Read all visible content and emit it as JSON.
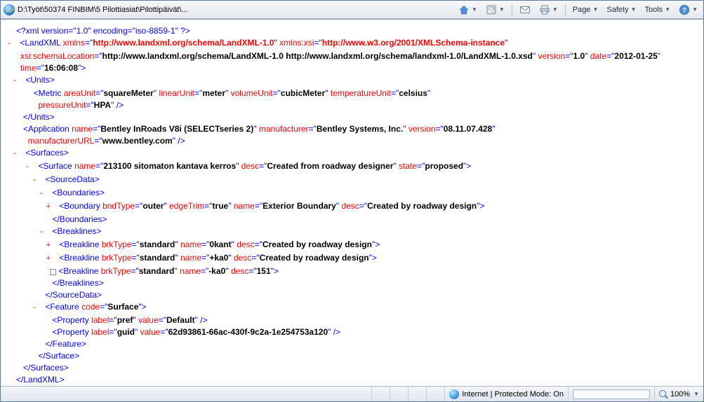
{
  "address": "D:\\Työt\\50374 FINBIM\\5 Pilottiasiat\\Pilottipäivät\\...",
  "toolbar": {
    "page": "Page",
    "safety": "Safety",
    "tools": "Tools"
  },
  "status": {
    "zone": "Internet | Protected Mode: On",
    "zoom": "100%"
  },
  "xml": {
    "pi": "<?xml version=\"1.0\" encoding=\"iso-8859-1\" ?>",
    "root_open": "<LandXML",
    "root_attrs": {
      "xmlns_k": "xmlns",
      "xmlns_v": "http://www.landxml.org/schema/LandXML-1.0",
      "xmlnsxsi_k": "xmlns:xsi",
      "xmlnsxsi_v": "http://www.w3.org/2001/XMLSchema-instance",
      "schemaLoc_k": "xsi:schemaLocation",
      "schemaLoc_v": "http://www.landxml.org/schema/LandXML-1.0 http://www.landxml.org/schema/landxml-1.0/LandXML-1.0.xsd",
      "version_k": "version",
      "version_v": "1.0",
      "date_k": "date",
      "date_v": "2012-01-25",
      "time_k": "time",
      "time_v": "16:06:08"
    },
    "units": {
      "open": "<Units>",
      "metric_open": "<Metric",
      "area_k": "areaUnit",
      "area_v": "squareMeter",
      "lin_k": "linearUnit",
      "lin_v": "meter",
      "vol_k": "volumeUnit",
      "vol_v": "cubicMeter",
      "temp_k": "temperatureUnit",
      "temp_v": "celsius",
      "press_k": "pressureUnit",
      "press_v": "HPA",
      "close": "</Units>"
    },
    "app": {
      "open": "<Application",
      "name_k": "name",
      "name_v": "Bentley InRoads V8i (SELECTseries 2)",
      "manu_k": "manufacturer",
      "manu_v": "Bentley Systems, Inc.",
      "ver_k": "version",
      "ver_v": "08.11.07.428",
      "url_k": "manufacturerURL",
      "url_v": "www.bentley.com"
    },
    "surfaces_open": "<Surfaces>",
    "surface": {
      "open": "<Surface",
      "name_k": "name",
      "name_v": "213100 sitomaton kantava kerros",
      "desc_k": "desc",
      "desc_v": "Created from roadway designer",
      "state_k": "state",
      "state_v": "proposed"
    },
    "sourcedata_open": "<SourceData>",
    "bounds_open": "<Boundaries>",
    "boundary": {
      "open": "<Boundary",
      "bnd_k": "bndType",
      "bnd_v": "outer",
      "et_k": "edgeTrim",
      "et_v": "true",
      "name_k": "name",
      "name_v": "Exterior Boundary",
      "desc_k": "desc",
      "desc_v": "Created by roadway design"
    },
    "bounds_close": "</Boundaries>",
    "breaks_open": "<Breaklines>",
    "bl1": {
      "open": "<Breakline",
      "tk": "brkType",
      "tv": "standard",
      "nk": "name",
      "nv": "0kant",
      "dk": "desc",
      "dv": "Created by roadway design"
    },
    "bl2": {
      "open": "<Breakline",
      "tk": "brkType",
      "tv": "standard",
      "nk": "name",
      "nv": "+ka0",
      "dk": "desc",
      "dv": "Created by roadway design"
    },
    "bl3": {
      "open": "<Breakline",
      "tk": "brkType",
      "tv": "standard",
      "nk": "name",
      "nv": "-ka0",
      "dk": "desc",
      "dv": "151"
    },
    "breaks_close": "</Breaklines>",
    "sourcedata_close": "</SourceData>",
    "feature_open": "<Feature",
    "feature_code_k": "code",
    "feature_code_v": "Surface",
    "prop1": {
      "open": "<Property",
      "lk": "label",
      "lv": "pref",
      "vk": "value",
      "vv": "Default"
    },
    "prop2": {
      "open": "<Property",
      "lk": "label",
      "lv": "guid",
      "vk": "value",
      "vv": "62d93861-66ac-430f-9c2a-1e254753a120"
    },
    "feature_close": "</Feature>",
    "surface_close": "</Surface>",
    "surfaces_close": "</Surfaces>",
    "root_close": "</LandXML>"
  }
}
